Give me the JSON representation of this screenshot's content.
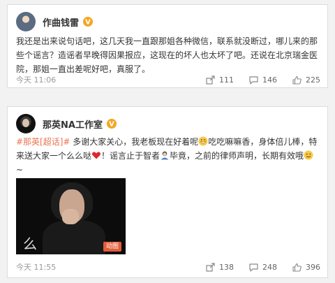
{
  "posts": [
    {
      "author": "作曲钱雷",
      "text_parts": [
        "我还是出来说句话吧，这几天我一直跟那姐各种微信，联系就没断过，哪儿来的那些个谣言？造谣者早晚得因果报应，这现在的坏人也太坏了吧。还说在北京瑞金医院，那姐一直出差呢好吧，真服了。"
      ],
      "timestamp": "今天 11:06",
      "actions": {
        "share": "111",
        "comment": "146",
        "like": "225"
      }
    },
    {
      "author": "那英NA工作室",
      "tag": "#那英[超话]#",
      "text_1": " 多谢大家关心，我老板现在好着呢",
      "text_2": "吃吃嘛嘛香，身体倍儿棒，特来送大家一个么么哒",
      "text_3": "！谣言止于智者",
      "text_4": "毕竟，之前的律师声明，长期有效哦",
      "text_5": "~",
      "media": {
        "overlay_char": "么",
        "badge": "动图"
      },
      "timestamp": "今天 11:55",
      "actions": {
        "share": "138",
        "comment": "248",
        "like": "396"
      }
    }
  ],
  "colors": {
    "accent": "#eb7350",
    "verified": "#f5a623",
    "meta": "#999999"
  },
  "icons": [
    "verified-badge-icon",
    "share-icon",
    "comment-icon",
    "like-icon",
    "grin-emoji-icon",
    "heart-emoji-icon",
    "person-emoji-icon",
    "smile-emoji-icon"
  ]
}
